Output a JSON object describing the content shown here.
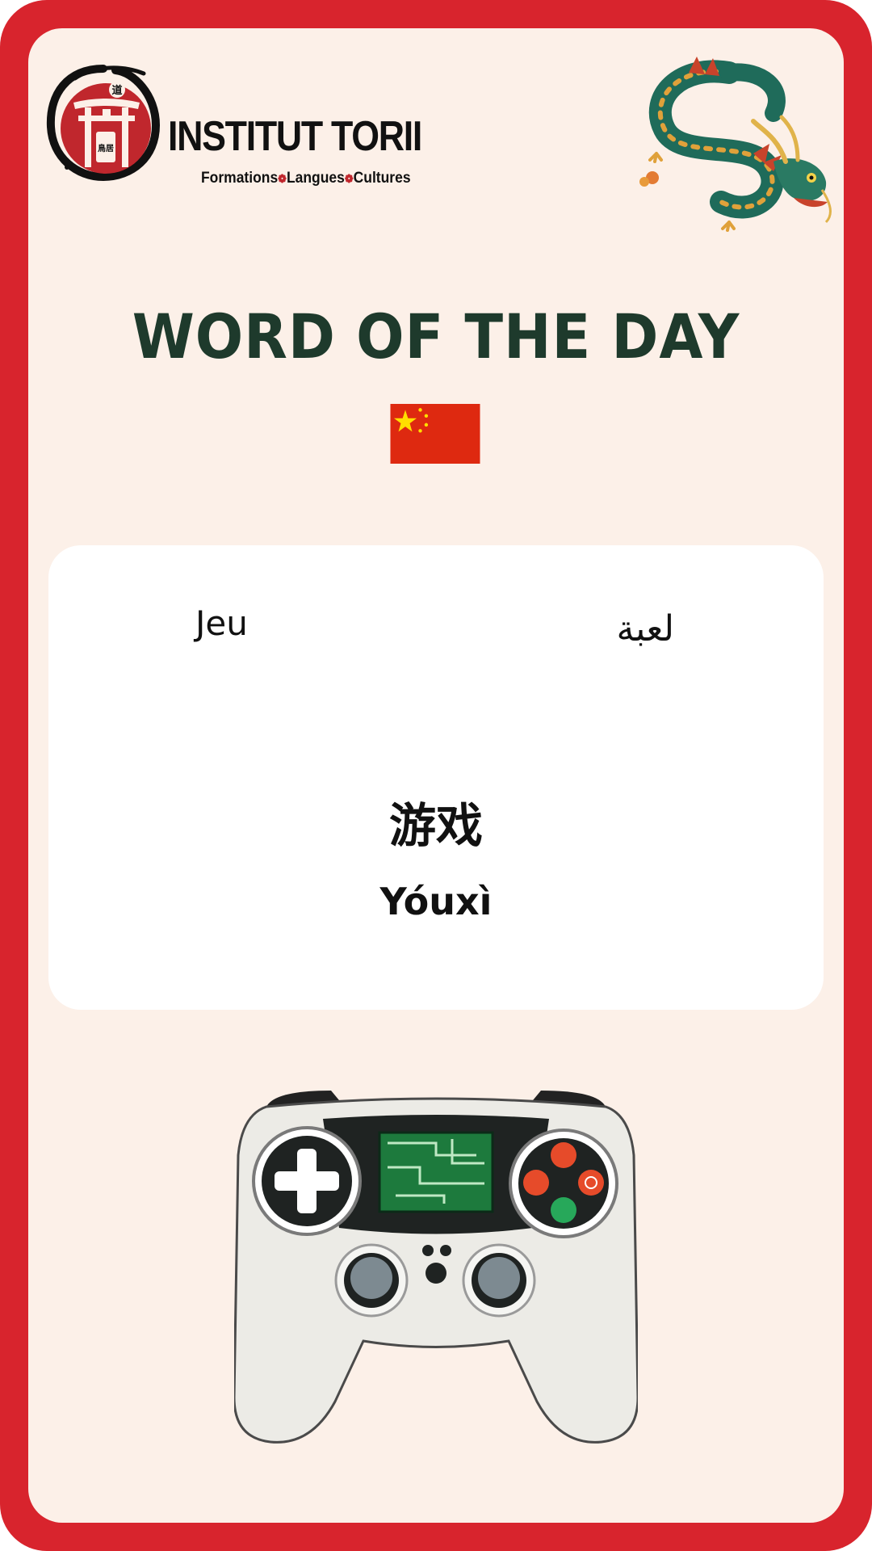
{
  "brand": {
    "name": "INSTITUT TORII",
    "tagline_parts": [
      "Formations",
      "Langues",
      "Cultures"
    ],
    "emblem_glyphs": [
      "道",
      "鳥居"
    ],
    "color_red": "#c0272d"
  },
  "heading": {
    "title": "WORD OF THE DAY",
    "color": "#1e3a2c"
  },
  "flag": {
    "country": "China",
    "icon": "china-flag-icon"
  },
  "word": {
    "french": "Jeu",
    "arabic": "لعبة",
    "chinese": "游戏",
    "pinyin": "Yóuxì"
  },
  "illustrations": {
    "top_right": "chinese-dragon-icon",
    "bottom": "game-controller-icon"
  },
  "colors": {
    "frame": "#d8242d",
    "card": "#fcf0e8",
    "panel": "#ffffff"
  }
}
